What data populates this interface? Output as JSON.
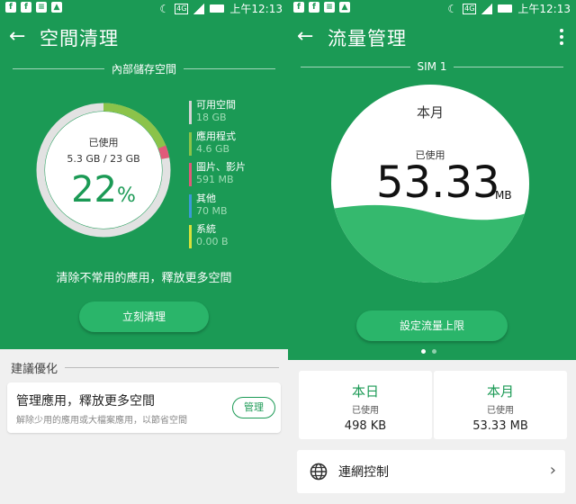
{
  "status": {
    "network": "4G",
    "time": "上午12:13"
  },
  "left": {
    "title": "空間清理",
    "section": "內部儲存空間",
    "donut": {
      "used_label": "已使用",
      "used_amount": "5.3 GB / 23 GB",
      "percent": "22",
      "percent_sign": "%",
      "used_fraction": 0.22
    },
    "legend": [
      {
        "name": "可用空間",
        "value": "18 GB",
        "color": "#d5d5d5"
      },
      {
        "name": "應用程式",
        "value": "4.6 GB",
        "color": "#8bc34a"
      },
      {
        "name": "圖片、影片",
        "value": "591 MB",
        "color": "#e05a7a"
      },
      {
        "name": "其他",
        "value": "70 MB",
        "color": "#3b9ad8"
      },
      {
        "name": "系統",
        "value": "0.00 B",
        "color": "#d7e23b"
      }
    ],
    "hint": "清除不常用的應用，釋放更多空間",
    "clean_button": "立刻清理",
    "suggest_title": "建議優化",
    "card": {
      "title": "管理應用，釋放更多空間",
      "subtitle": "解除少用的應用或大檔案應用，以節省空間",
      "button": "管理"
    }
  },
  "right": {
    "title": "流量管理",
    "sim": "SIM 1",
    "gauge": {
      "period": "本月",
      "used_label": "已使用",
      "value": "53.33",
      "unit": "MB"
    },
    "limit_button": "設定流量上限",
    "pager": {
      "pages": 2,
      "active": 0
    },
    "today": {
      "title": "本日",
      "used_label": "已使用",
      "value": "498 KB"
    },
    "month": {
      "title": "本月",
      "used_label": "已使用",
      "value": "53.33 MB"
    },
    "net_control": "連網控制"
  },
  "colors": {
    "primary": "#1b9a55",
    "button": "#2ab56a",
    "wave": "#35b96e"
  }
}
